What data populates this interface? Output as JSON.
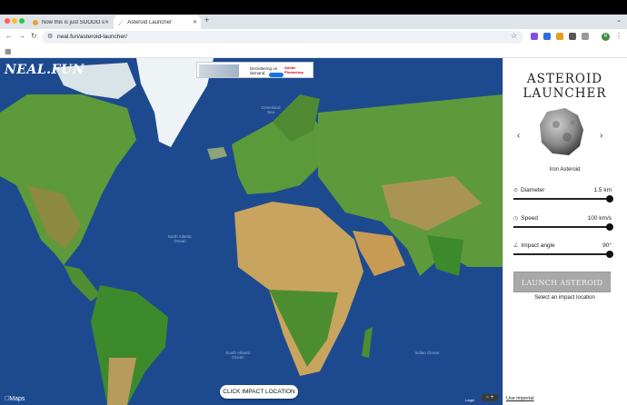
{
  "browser": {
    "tabs": [
      {
        "title": "Now this is just SOOOO sad",
        "active": false
      },
      {
        "title": "Asteroid Launcher",
        "active": true
      }
    ],
    "new_tab": "+",
    "url": "neal.fun/asteroid-launcher/"
  },
  "site": {
    "logo": "NEAL.FUN"
  },
  "ad": {
    "headline": "Decluttering on demand.",
    "brand": "Adobe Photoshop"
  },
  "map": {
    "ocean_labels": {
      "north_atlantic": "North Atlantic Ocean",
      "south_atlantic": "South Atlantic Ocean",
      "indian": "Indian Ocean",
      "greenland_sea": "Greenland Sea"
    },
    "impact_button": "CLICK IMPACT LOCATION",
    "maps_brand": "Maps",
    "legal": "Legal",
    "zoom": "− +"
  },
  "panel": {
    "title_line1": "ASTEROID",
    "title_line2": "LAUNCHER",
    "prev": "‹",
    "next": "›",
    "asteroid_name": "Iron Asteroid",
    "controls": {
      "diameter": {
        "label": "Diameter",
        "value": "1.5 km",
        "fraction": 1.0
      },
      "speed": {
        "label": "Speed",
        "value": "100 km/s",
        "fraction": 1.0
      },
      "angle": {
        "label": "Impact angle",
        "value": "90°",
        "fraction": 1.0
      }
    },
    "launch_button": "LAUNCH ASTEROID",
    "hint": "Select an impact location",
    "imperial_link": "Use imperial"
  },
  "colors": {
    "ocean": "#1d4a8f",
    "land": "#5b9a3a",
    "desert": "#c9a45e",
    "ice": "#eef3f6",
    "launch_disabled": "#a8a8a8"
  }
}
